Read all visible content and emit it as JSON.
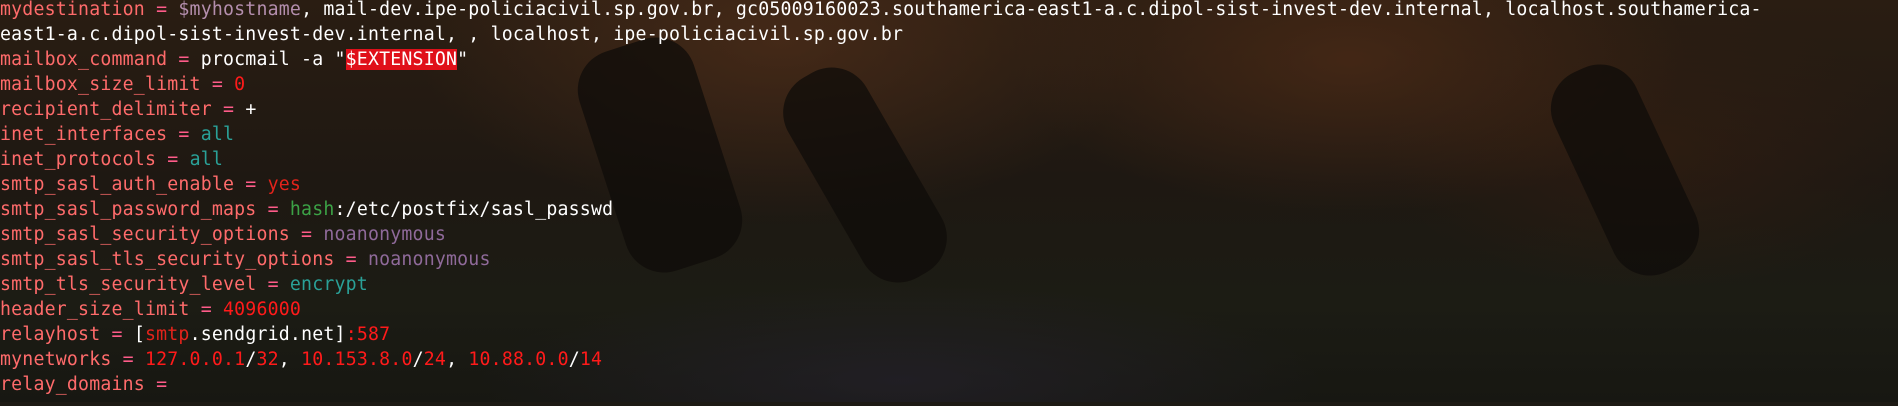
{
  "terminal": {
    "lines": [
      {
        "key": "mydestination",
        "op": " = ",
        "parts": [
          {
            "t": "$myhostname",
            "c": "var"
          },
          {
            "t": ", mail-dev.ipe-policiacivil.sp.gov.br, gc05009160023.southamerica-east1-a.c.dipol-sist-invest-dev.internal, localhost.southamerica-",
            "c": "val"
          }
        ]
      },
      {
        "key": "",
        "op": "",
        "parts": [
          {
            "t": "east1-a.c.dipol-sist-invest-dev.internal, , localhost, ipe-policiacivil.sp.gov.br",
            "c": "val"
          }
        ]
      },
      {
        "key": "mailbox_command",
        "op": " = ",
        "parts": [
          {
            "t": "procmail -a \"",
            "c": "val"
          },
          {
            "t": "$EXTENSION",
            "c": "hl"
          },
          {
            "t": "\"",
            "c": "val"
          }
        ]
      },
      {
        "key": "mailbox_size_limit",
        "op": " = ",
        "parts": [
          {
            "t": "0",
            "c": "num"
          }
        ]
      },
      {
        "key": "recipient_delimiter",
        "op": " = ",
        "parts": [
          {
            "t": "+",
            "c": "val"
          }
        ]
      },
      {
        "key": "inet_interfaces",
        "op": " = ",
        "parts": [
          {
            "t": "all",
            "c": "kw-teal"
          }
        ]
      },
      {
        "key": "inet_protocols",
        "op": " = ",
        "parts": [
          {
            "t": "all",
            "c": "kw-teal"
          }
        ]
      },
      {
        "key": "smtp_sasl_auth_enable",
        "op": " = ",
        "parts": [
          {
            "t": "yes",
            "c": "kw-red"
          }
        ]
      },
      {
        "key": "smtp_sasl_password_maps",
        "op": " = ",
        "parts": [
          {
            "t": "hash",
            "c": "kw-green"
          },
          {
            "t": ":/etc/postfix/sasl_passwd",
            "c": "val"
          }
        ]
      },
      {
        "key": "smtp_sasl_security_options",
        "op": " = ",
        "parts": [
          {
            "t": "noanonymous",
            "c": "kw-purple"
          }
        ]
      },
      {
        "key": "smtp_sasl_tls_security_options",
        "op": " = ",
        "parts": [
          {
            "t": "noanonymous",
            "c": "kw-purple"
          }
        ]
      },
      {
        "key": "smtp_tls_security_level",
        "op": " = ",
        "parts": [
          {
            "t": "encrypt",
            "c": "kw-teal"
          }
        ]
      },
      {
        "key": "header_size_limit",
        "op": " = ",
        "parts": [
          {
            "t": "4096000",
            "c": "num"
          }
        ]
      },
      {
        "key": "relayhost",
        "op": " = ",
        "parts": [
          {
            "t": "[",
            "c": "val"
          },
          {
            "t": "smtp",
            "c": "kw-red"
          },
          {
            "t": ".sendgrid.net]",
            "c": "val"
          },
          {
            "t": ":587",
            "c": "num"
          }
        ]
      },
      {
        "key": "mynetworks",
        "op": " = ",
        "parts": [
          {
            "t": "127.0.0.1",
            "c": "num"
          },
          {
            "t": "/",
            "c": "val"
          },
          {
            "t": "32",
            "c": "num"
          },
          {
            "t": ", ",
            "c": "val"
          },
          {
            "t": "10.153.8.0",
            "c": "num"
          },
          {
            "t": "/",
            "c": "val"
          },
          {
            "t": "24",
            "c": "num"
          },
          {
            "t": ", ",
            "c": "val"
          },
          {
            "t": "10.88.0.0",
            "c": "num"
          },
          {
            "t": "/",
            "c": "val"
          },
          {
            "t": "14",
            "c": "num"
          }
        ]
      },
      {
        "key": "relay_domains",
        "op": " =",
        "parts": []
      }
    ]
  }
}
